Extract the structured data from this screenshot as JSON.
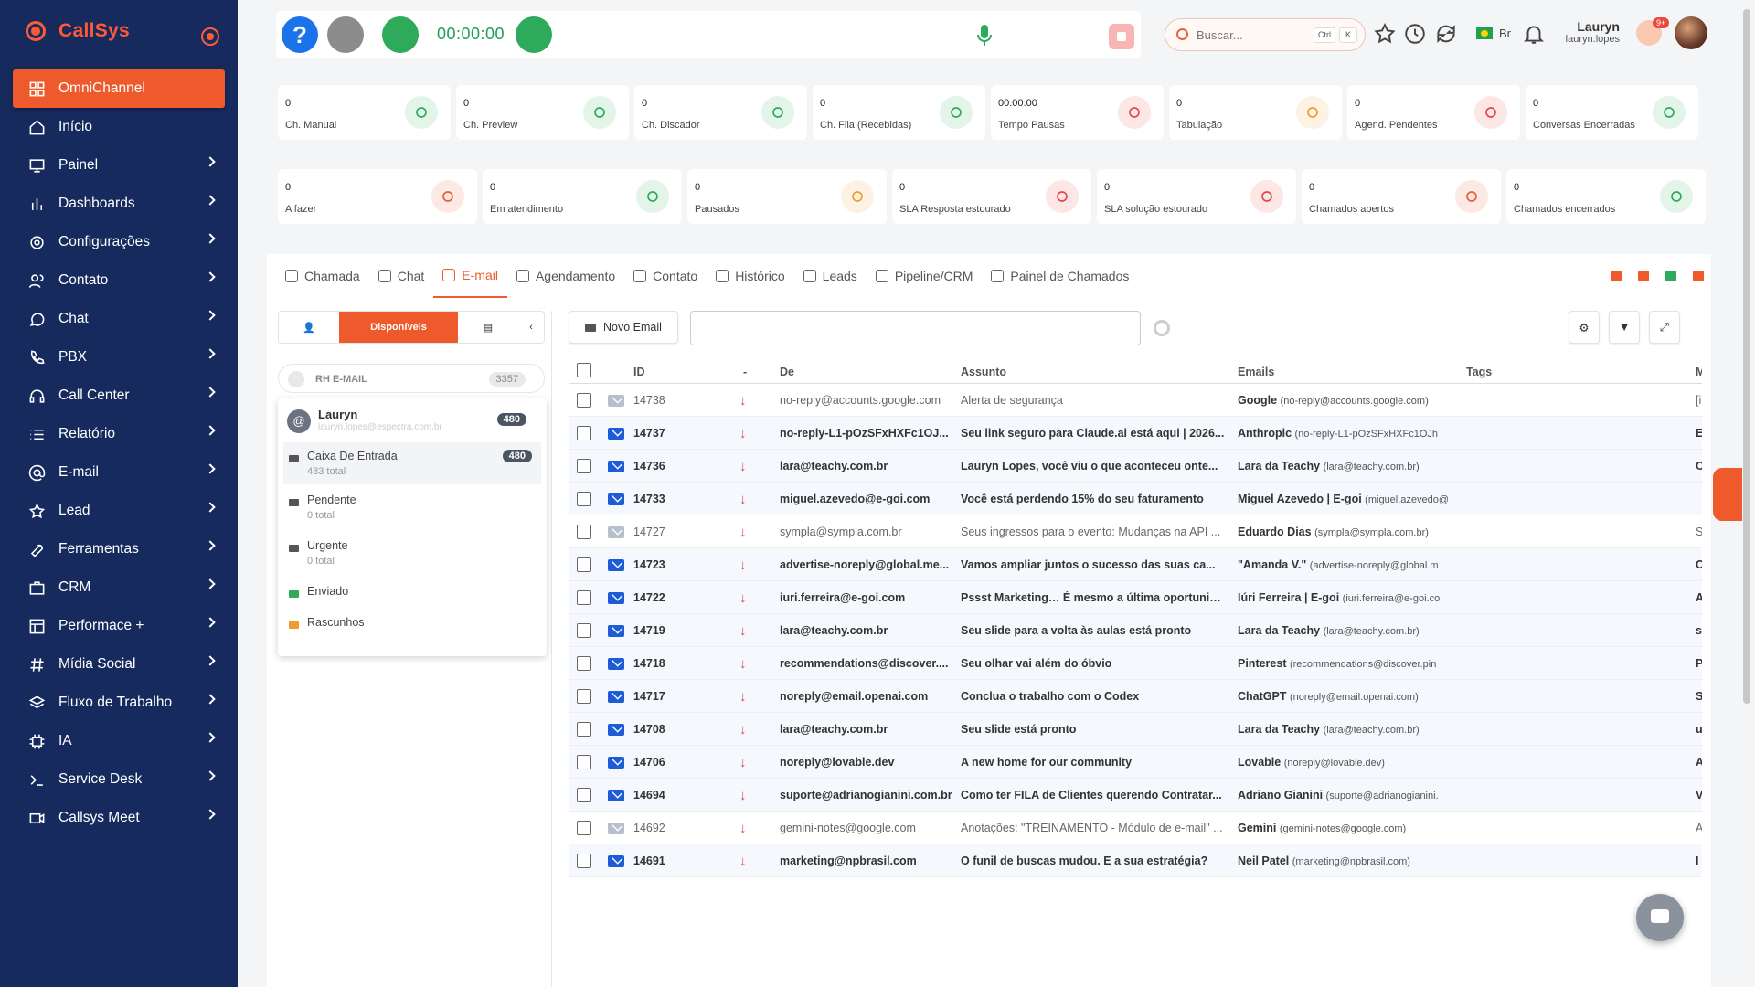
{
  "brand": {
    "name": "CallSys"
  },
  "sidebar": {
    "items": [
      {
        "label": "OmniChannel",
        "icon": "grid-icon",
        "active": true
      },
      {
        "label": "Início",
        "icon": "home-icon"
      },
      {
        "label": "Painel",
        "icon": "monitor-icon"
      },
      {
        "label": "Dashboards",
        "icon": "bar-chart-icon"
      },
      {
        "label": "Configurações",
        "icon": "gear-icon"
      },
      {
        "label": "Contato",
        "icon": "users-icon"
      },
      {
        "label": "Chat",
        "icon": "chat-bubble-icon"
      },
      {
        "label": "PBX",
        "icon": "phone-icon"
      },
      {
        "label": "Call Center",
        "icon": "headset-icon"
      },
      {
        "label": "Relatório",
        "icon": "list-icon"
      },
      {
        "label": "E-mail",
        "icon": "at-icon"
      },
      {
        "label": "Lead",
        "icon": "star-icon"
      },
      {
        "label": "Ferramentas",
        "icon": "wrench-icon"
      },
      {
        "label": "CRM",
        "icon": "briefcase-icon"
      },
      {
        "label": "Performace +",
        "icon": "layout-icon"
      },
      {
        "label": "Mídia Social",
        "icon": "hashtag-icon"
      },
      {
        "label": "Fluxo de Trabalho",
        "icon": "layers-icon"
      },
      {
        "label": "IA",
        "icon": "cpu-icon"
      },
      {
        "label": "Service Desk",
        "icon": "terminal-icon"
      },
      {
        "label": "Callsys Meet",
        "icon": "video-icon"
      }
    ]
  },
  "topbar": {
    "timer": "00:00:00",
    "search_placeholder": "Buscar...",
    "kbd1": "Ctrl",
    "kbd2": "K",
    "lang": "Br",
    "user_name": "Lauryn",
    "user_login": "lauryn.lopes",
    "notif_badge": "9+"
  },
  "stats_row1": [
    {
      "value": "0",
      "label": "Ch. Manual",
      "color": "#2eaa5b"
    },
    {
      "value": "0",
      "label": "Ch. Preview",
      "color": "#2eaa5b"
    },
    {
      "value": "0",
      "label": "Ch. Discador",
      "color": "#2eaa5b"
    },
    {
      "value": "0",
      "label": "Ch. Fila (Recebidas)",
      "color": "#2eaa5b"
    },
    {
      "value": "00:00:00",
      "label": "Tempo Pausas",
      "color": "#e84545"
    },
    {
      "value": "0",
      "label": "Tabulação",
      "color": "#f29a2e"
    },
    {
      "value": "0",
      "label": "Agend. Pendentes",
      "color": "#e84545"
    },
    {
      "value": "0",
      "label": "Conversas Encerradas",
      "color": "#2eaa5b"
    }
  ],
  "stats_row2": [
    {
      "value": "0",
      "label": "A fazer",
      "color": "#ee5a2c"
    },
    {
      "value": "0",
      "label": "Em atendimento",
      "color": "#2eaa5b"
    },
    {
      "value": "0",
      "label": "Pausados",
      "color": "#f29a2e"
    },
    {
      "value": "0",
      "label": "SLA Resposta estourado",
      "color": "#e84545"
    },
    {
      "value": "0",
      "label": "SLA solução estourado",
      "color": "#e84545"
    },
    {
      "value": "0",
      "label": "Chamados abertos",
      "color": "#ee5a2c"
    },
    {
      "value": "0",
      "label": "Chamados encerrados",
      "color": "#2eaa5b"
    }
  ],
  "tabs": [
    {
      "label": "Chamada"
    },
    {
      "label": "Chat"
    },
    {
      "label": "E-mail",
      "active": true
    },
    {
      "label": "Agendamento"
    },
    {
      "label": "Contato"
    },
    {
      "label": "Histórico"
    },
    {
      "label": "Leads"
    },
    {
      "label": "Pipeline/CRM"
    },
    {
      "label": "Painel de Chamados"
    }
  ],
  "mail": {
    "segment_label": "Disponíveis",
    "mailbox_label": "RH E-MAIL",
    "mailbox_count": "3357",
    "account": {
      "initial": "@",
      "name": "Lauryn",
      "email": "lauryn.lopes@espectra.com.br",
      "count": "480"
    },
    "folders": [
      {
        "name": "Caixa De Entrada",
        "total": "483 total",
        "count": "480",
        "selected": true
      },
      {
        "name": "Pendente",
        "total": "0 total"
      },
      {
        "name": "Urgente",
        "total": "0 total"
      },
      {
        "name": "Enviado",
        "total": ""
      },
      {
        "name": "Rascunhos",
        "total": ""
      }
    ],
    "new_email_label": "Novo Email",
    "columns": {
      "id": "ID",
      "dash": "-",
      "from": "De",
      "subject": "Assunto",
      "emails": "Emails",
      "tags": "Tags",
      "more": "M"
    },
    "rows": [
      {
        "id": "14738",
        "from": "no-reply@accounts.google.com",
        "subject": "Alerta de segurança",
        "sender": "Google",
        "addr": "(no-reply@accounts.google.com)",
        "extra": "[i",
        "read": true
      },
      {
        "id": "14737",
        "from": "no-reply-L1-pOzSFxHXFc1OJ...",
        "subject": "Seu link seguro para Claude.ai está aqui | 2026...",
        "sender": "Anthropic",
        "addr": "(no-reply-L1-pOzSFxHXFc1OJh",
        "extra": "E"
      },
      {
        "id": "14736",
        "from": "lara@teachy.com.br",
        "subject": "Lauryn Lopes, você viu o que aconteceu onte...",
        "sender": "Lara da Teachy",
        "addr": "(lara@teachy.com.br)",
        "extra": "C"
      },
      {
        "id": "14733",
        "from": "miguel.azevedo@e-goi.com",
        "subject": "Você está perdendo 15% do seu faturamento",
        "sender": "Miguel Azevedo | E-goi",
        "addr": "(miguel.azevedo@",
        "extra": ""
      },
      {
        "id": "14727",
        "from": "sympla@sympla.com.br",
        "subject": "Seus ingressos para o evento: Mudanças na API ...",
        "sender": "Eduardo Dias",
        "addr": "(sympla@sympla.com.br)",
        "extra": "S",
        "read": true
      },
      {
        "id": "14723",
        "from": "advertise-noreply@global.me...",
        "subject": "Vamos ampliar juntos o sucesso das suas ca...",
        "sender": "\"Amanda V.\"",
        "addr": "(advertise-noreply@global.m",
        "extra": "C"
      },
      {
        "id": "14722",
        "from": "iuri.ferreira@e-goi.com",
        "subject": "Pssst Marketing… É mesmo a última oportunid...",
        "sender": "Iúri Ferreira | E-goi",
        "addr": "(iuri.ferreira@e-goi.co",
        "extra": "A"
      },
      {
        "id": "14719",
        "from": "lara@teachy.com.br",
        "subject": "Seu slide para a volta às aulas está pronto",
        "sender": "Lara da Teachy",
        "addr": "(lara@teachy.com.br)",
        "extra": "s"
      },
      {
        "id": "14718",
        "from": "recommendations@discover....",
        "subject": "Seu olhar vai além do óbvio",
        "sender": "Pinterest",
        "addr": "(recommendations@discover.pin",
        "extra": "P"
      },
      {
        "id": "14717",
        "from": "noreply@email.openai.com",
        "subject": "Conclua o trabalho com o Codex",
        "sender": "ChatGPT",
        "addr": "(noreply@email.openai.com)",
        "extra": "S"
      },
      {
        "id": "14708",
        "from": "lara@teachy.com.br",
        "subject": "Seu slide está pronto",
        "sender": "Lara da Teachy",
        "addr": "(lara@teachy.com.br)",
        "extra": "u"
      },
      {
        "id": "14706",
        "from": "noreply@lovable.dev",
        "subject": "A new home for our community",
        "sender": "Lovable",
        "addr": "(noreply@lovable.dev)",
        "extra": "A"
      },
      {
        "id": "14694",
        "from": "suporte@adrianogianini.com.br",
        "subject": "Como ter FILA de Clientes querendo Contratar...",
        "sender": "Adriano Gianini",
        "addr": "(suporte@adrianogianini.",
        "extra": "V"
      },
      {
        "id": "14692",
        "from": "gemini-notes@google.com",
        "subject": "Anotações: \"TREINAMENTO - Módulo de e-mail\" ...",
        "sender": "Gemini",
        "addr": "(gemini-notes@google.com)",
        "extra": "A",
        "read": true
      },
      {
        "id": "14691",
        "from": "marketing@npbrasil.com",
        "subject": "O funil de buscas mudou. E a sua estratégia?",
        "sender": "Neil Patel",
        "addr": "(marketing@npbrasil.com)",
        "extra": "I"
      }
    ]
  }
}
